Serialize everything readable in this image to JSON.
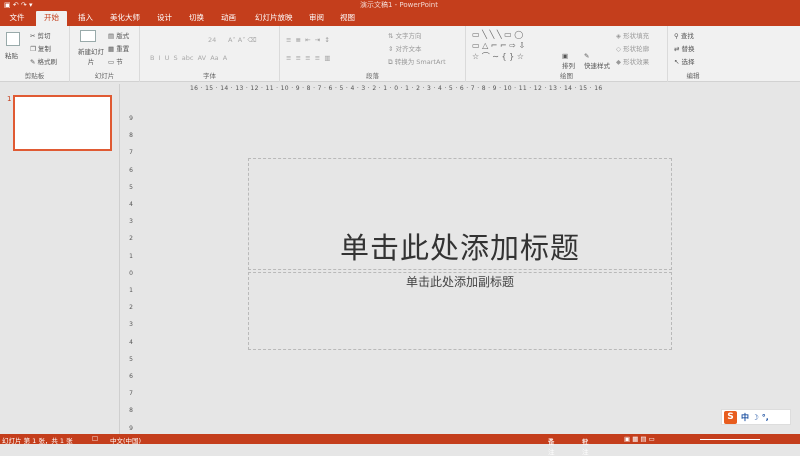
{
  "window": {
    "doc_title": "演示文稿1 - PowerPoint"
  },
  "tabs": [
    "文件",
    "开始",
    "插入",
    "美化大师",
    "设计",
    "切换",
    "动画",
    "幻灯片放映",
    "审阅",
    "视图"
  ],
  "ribbon": {
    "clipboard": {
      "label": "剪贴板",
      "paste": "粘贴",
      "cut": "剪切",
      "copy": "复制",
      "format_painter": "格式刷"
    },
    "slides": {
      "label": "幻灯片",
      "new_slide": "新建幻灯片",
      "layout": "版式",
      "reset": "重置",
      "section": "节"
    },
    "font": {
      "label": "字体",
      "size": "24"
    },
    "paragraph": {
      "label": "段落",
      "text_dir": "文字方向",
      "align_text": "对齐文本",
      "smartart": "转换为 SmartArt"
    },
    "drawing": {
      "label": "绘图",
      "arrange": "排列",
      "quick_styles": "快速样式",
      "fill": "形状填充",
      "outline": "形状轮廓",
      "effects": "形状效果"
    },
    "editing": {
      "label": "编辑",
      "find": "查找",
      "replace": "替换",
      "select": "选择"
    }
  },
  "ruler_ticks": "16 · 15 · 14 · 13 · 12 · 11 · 10 · 9 · 8 · 7 · 6 · 5 · 4 · 3 · 2 · 1 · 0 · 1 · 2 · 3 · 4 · 5 · 6 · 7 · 8 · 9 · 10 · 11 · 12 · 13 · 14 · 15 · 16",
  "vruler_ticks": [
    "9",
    "8",
    "7",
    "6",
    "5",
    "4",
    "3",
    "2",
    "1",
    "0",
    "1",
    "2",
    "3",
    "4",
    "5",
    "6",
    "7",
    "8",
    "9"
  ],
  "thumb_number": "1",
  "slide": {
    "title_placeholder": "单击此处添加标题",
    "subtitle_placeholder": "单击此处添加副标题"
  },
  "status": {
    "slide_info": "幻灯片 第 1 张，共 1 张",
    "language": "中文(中国)",
    "notes": "备注",
    "comments": "批注"
  },
  "ime": {
    "logo": "S",
    "mode": "中 ☽ °,"
  },
  "colors": {
    "accent": "#c43e1c",
    "thumb_border": "#e05a33"
  }
}
